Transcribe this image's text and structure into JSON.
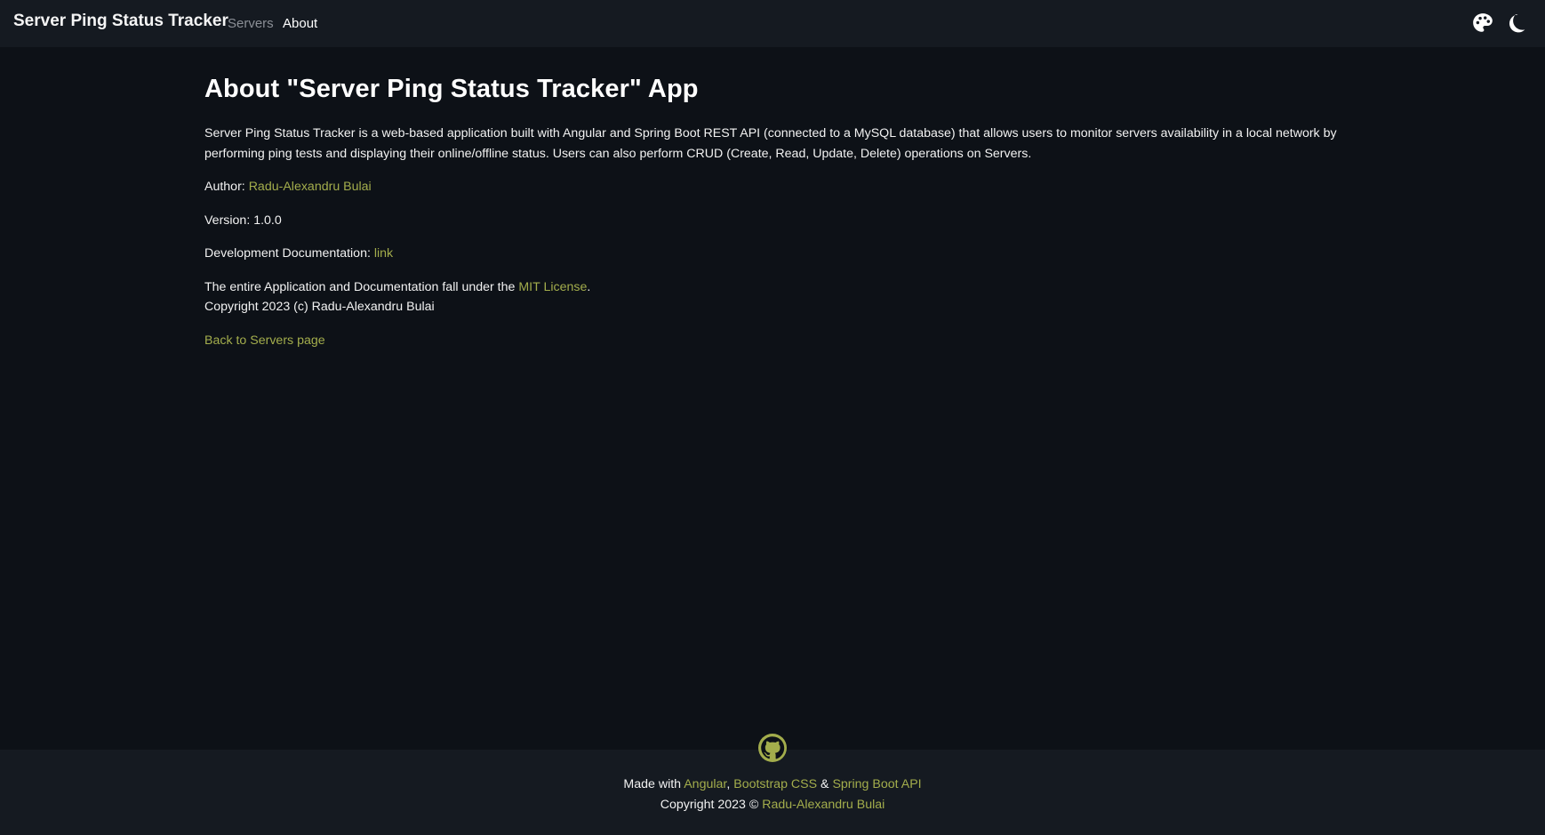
{
  "navbar": {
    "brand": "Server Ping Status Tracker",
    "links": [
      {
        "label": "Servers",
        "active": false
      },
      {
        "label": "About",
        "active": true
      }
    ],
    "icons": [
      "palette-icon",
      "moon-icon"
    ]
  },
  "main": {
    "title": "About \"Server Ping Status Tracker\" App",
    "description": "Server Ping Status Tracker is a web-based application built with Angular and Spring Boot REST API (connected to a MySQL database) that allows users to monitor servers availability in a local network by performing ping tests and displaying their online/offline status. Users can also perform CRUD (Create, Read, Update, Delete) operations on Servers.",
    "author_label": "Author: ",
    "author_name": "Radu-Alexandru Bulai",
    "version_text": "Version: 1.0.0",
    "docs_label": "Development Documentation: ",
    "docs_link": "link",
    "license_prefix": "The entire Application and Documentation fall under the ",
    "license_link": "MIT License",
    "license_suffix": ".",
    "copyright": "Copyright 2023 (c) Radu-Alexandru Bulai",
    "back_link": "Back to Servers page"
  },
  "footer": {
    "icon": "github-icon",
    "made_with": "Made with ",
    "angular": "Angular",
    "comma": ", ",
    "bootstrap": "Bootstrap CSS",
    "amp": " & ",
    "spring": "Spring Boot API",
    "copyright_prefix": "Copyright 2023 © ",
    "author": "Radu-Alexandru Bulai"
  },
  "colors": {
    "background": "#0d1117",
    "navbar": "#151a21",
    "link": "#a3ad4c",
    "text": "#f2f2f2"
  }
}
